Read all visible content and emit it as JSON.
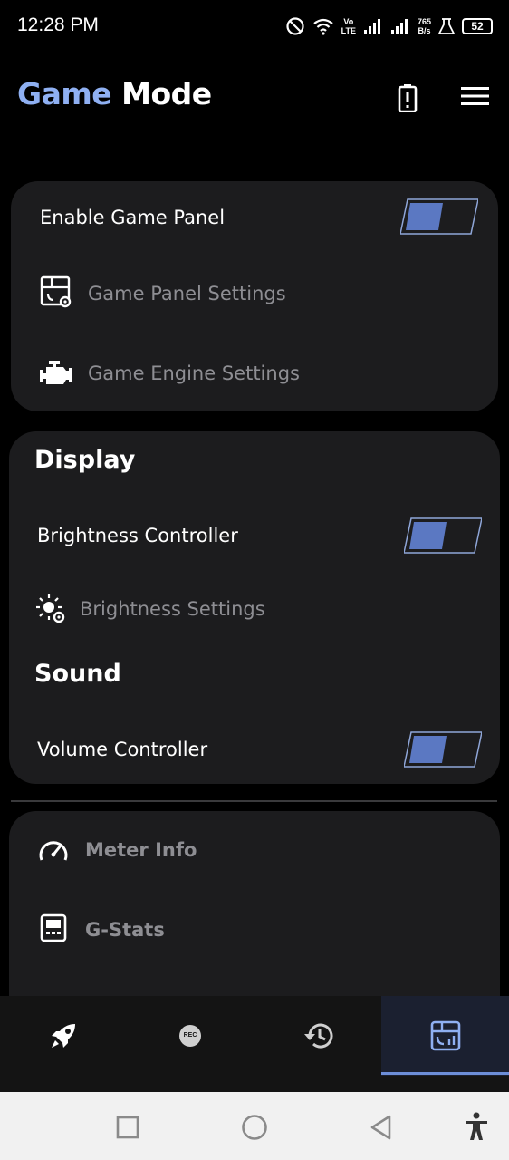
{
  "status_bar": {
    "time": "12:28 PM",
    "volte_top": "Vo",
    "volte_bottom": "LTE",
    "speed_top": "765",
    "speed_bottom": "B/s",
    "battery": "52"
  },
  "header": {
    "title_part1": "Game",
    "title_part2": "Mode"
  },
  "game_card": {
    "enable_label": "Enable Game Panel",
    "enable_on": true,
    "panel_settings_label": "Game Panel Settings",
    "engine_settings_label": "Game Engine Settings"
  },
  "display_card": {
    "display_title": "Display",
    "brightness_controller_label": "Brightness Controller",
    "brightness_controller_on": true,
    "brightness_settings_label": "Brightness Settings",
    "sound_title": "Sound",
    "volume_controller_label": "Volume Controller",
    "volume_controller_on": true
  },
  "tools_card": {
    "meter_info_label": "Meter Info",
    "gstats_label": "G-Stats"
  },
  "bottom_nav": {
    "rec_text": "REC",
    "active_tab": "stats-tab"
  },
  "colors": {
    "accent": "#8fb0f2",
    "toggle_fill": "#5b78c2",
    "toggle_outline": "#8fa6d8",
    "card_bg": "#1c1c1e",
    "dim_text": "#8e8e93"
  }
}
